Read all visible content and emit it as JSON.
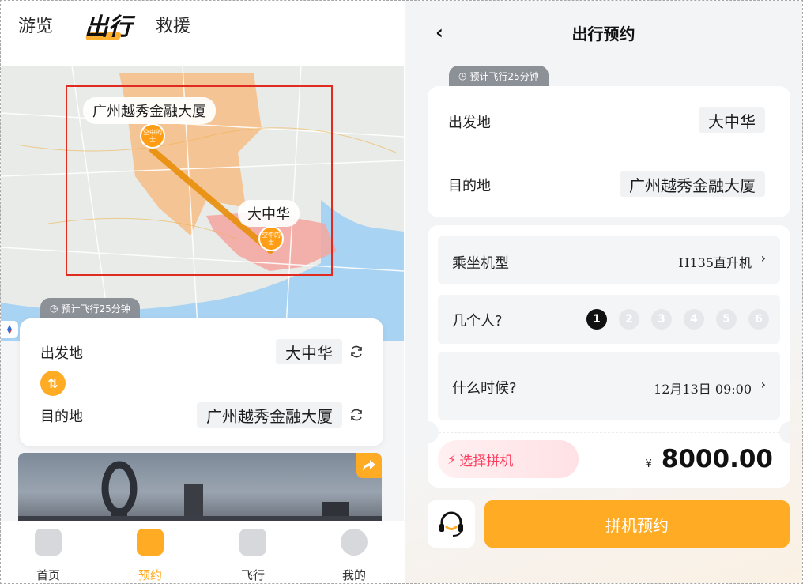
{
  "left": {
    "tabs": [
      {
        "label": "游览"
      },
      {
        "label": "出行"
      },
      {
        "label": "救援"
      }
    ],
    "map": {
      "origin_label": "广州越秀金融大厦",
      "destination_label": "大中华",
      "origin_pin_text": "空中的士",
      "destination_pin_text": "空中的士"
    },
    "eta_tag": "预计飞行25分钟",
    "route": {
      "from_label": "出发地",
      "from_value": "大中华",
      "to_label": "目的地",
      "to_value": "广州越秀金融大厦",
      "swap_symbol": "⇅"
    },
    "bottom_nav": [
      {
        "label": "首页",
        "icon": "pie-chart-icon"
      },
      {
        "label": "预约",
        "icon": "calendar-check-icon",
        "active": true
      },
      {
        "label": "飞行",
        "icon": "helicopter-icon"
      },
      {
        "label": "我的",
        "icon": "smile-icon"
      }
    ]
  },
  "right": {
    "title": "出行预约",
    "eta_tag": "预计飞行25分钟",
    "route": {
      "from_label": "出发地",
      "from_value": "大中华",
      "to_label": "目的地",
      "to_value": "广州越秀金融大厦"
    },
    "aircraft": {
      "label": "乘坐机型",
      "value": "H135直升机"
    },
    "passengers": {
      "label": "几个人?",
      "options": [
        "1",
        "2",
        "3",
        "4",
        "5",
        "6"
      ],
      "selected": "1"
    },
    "time": {
      "label": "什么时候?",
      "value": "12月13日 09:00"
    },
    "carpool_label": "选择拼机",
    "price": {
      "currency": "¥",
      "amount": "8000.00"
    },
    "book_button": "拼机预约"
  },
  "colors": {
    "accent": "#ffab24",
    "highlight_red": "#e12a20",
    "carpool_red": "#ff3b5c"
  }
}
